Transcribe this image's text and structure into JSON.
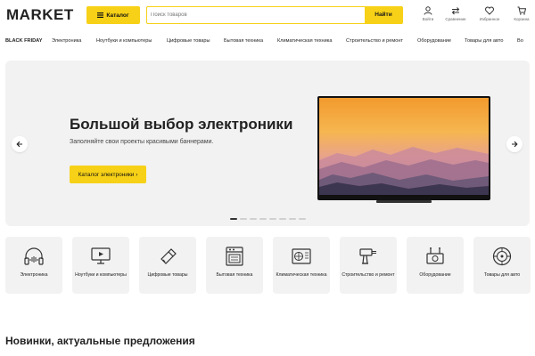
{
  "header": {
    "logo": "MARKET",
    "catalog_label": "Каталог",
    "search_placeholder": "Поиск товаров",
    "search_button": "Найти",
    "icons": [
      {
        "label": "Войти",
        "icon": "user-icon"
      },
      {
        "label": "Сравнение",
        "icon": "compare-icon"
      },
      {
        "label": "Избранное",
        "icon": "heart-icon"
      },
      {
        "label": "Корзина",
        "icon": "cart-icon"
      }
    ]
  },
  "nav": {
    "items": [
      "BLACK FRIDAY",
      "Электроника",
      "Ноутбуки и компьютеры",
      "Цифровые товары",
      "Бытовая техника",
      "Климатическая техника",
      "Строительство и ремонт",
      "Оборудование",
      "Товары для авто",
      "Во"
    ]
  },
  "hero": {
    "title": "Большой выбор электроники",
    "subtitle": "Заполняйте свои проекты красивыми баннерами.",
    "button_label": "Каталог электроники ›",
    "slides_total": 8,
    "active_slide": 1
  },
  "categories": [
    {
      "label": "Электроника",
      "icon": "headphones-icon"
    },
    {
      "label": "Ноутбуки и компьютеры",
      "icon": "monitor-icon"
    },
    {
      "label": "Цифровые товары",
      "icon": "usb-drive-icon"
    },
    {
      "label": "Бытовая техника",
      "icon": "oven-icon"
    },
    {
      "label": "Климатическая техника",
      "icon": "air-conditioner-icon"
    },
    {
      "label": "Строительство и ремонт",
      "icon": "drill-icon"
    },
    {
      "label": "Оборудование",
      "icon": "equipment-icon"
    },
    {
      "label": "Товары для авто",
      "icon": "wheel-icon"
    }
  ],
  "section": {
    "title": "Новинки, актуальные предложения"
  },
  "colors": {
    "accent": "#f7d117",
    "background": "#ffffff",
    "card": "#f2f2f2"
  }
}
